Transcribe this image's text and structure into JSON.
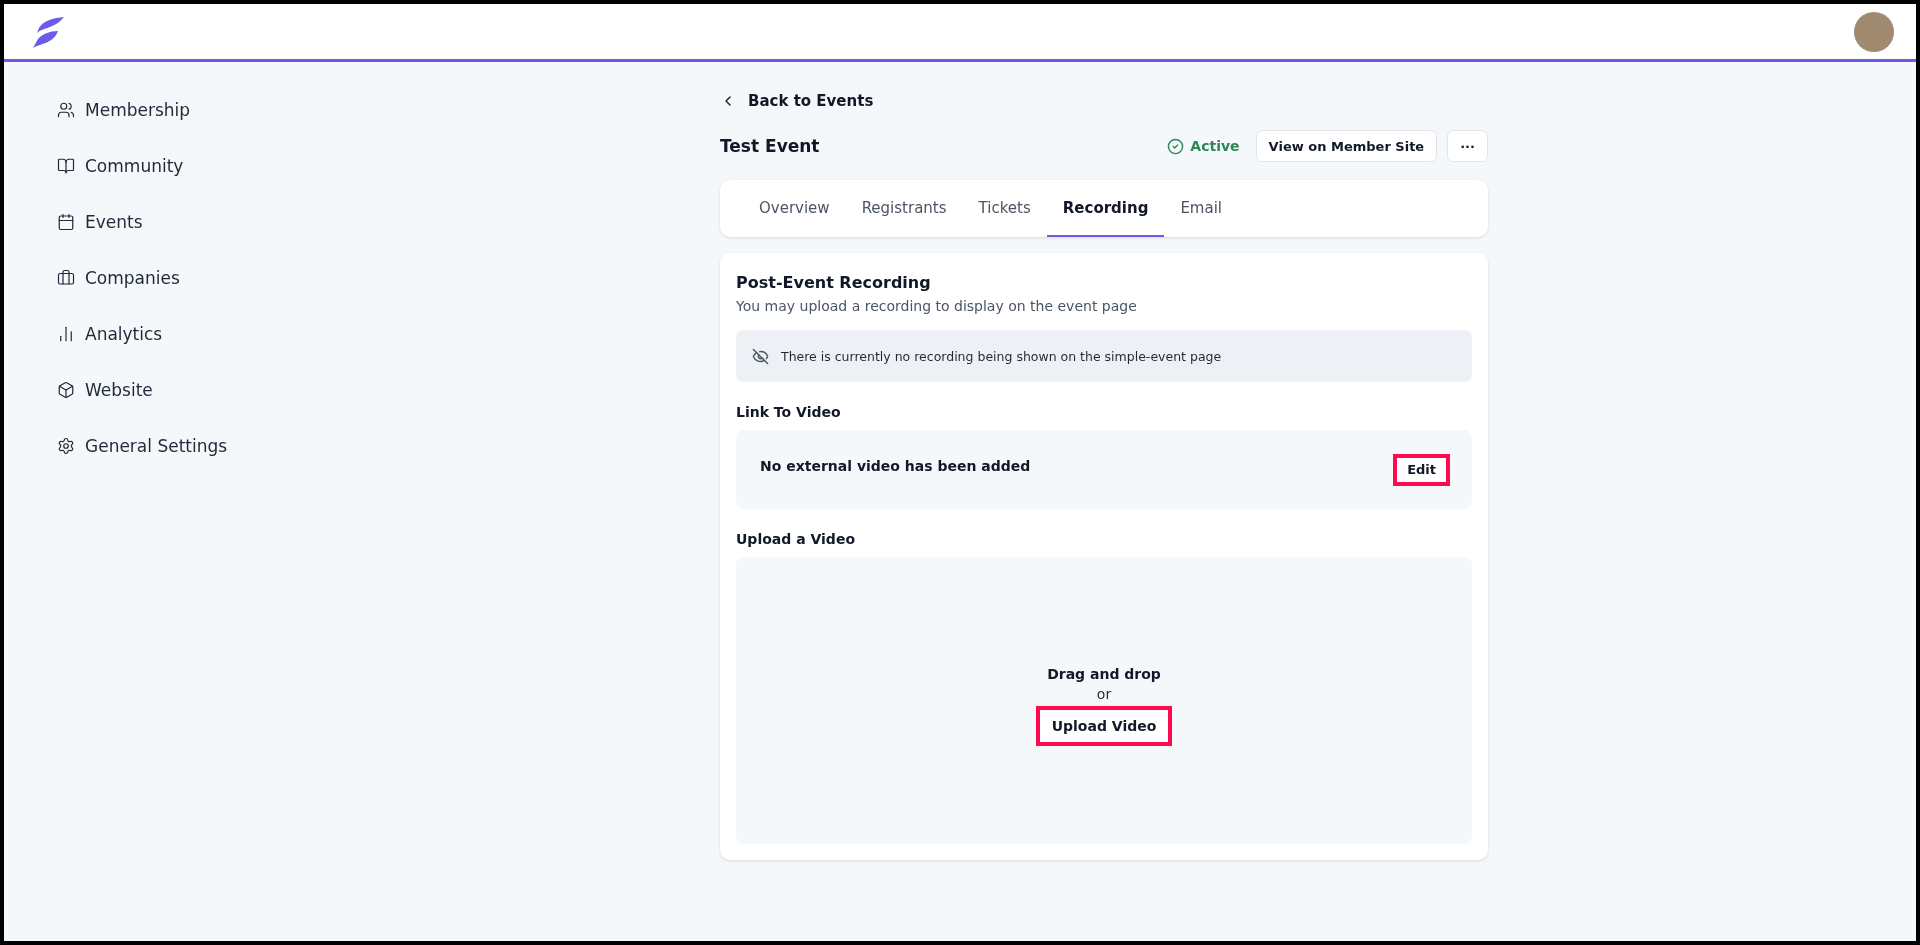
{
  "sidebar": {
    "items": [
      {
        "label": "Membership"
      },
      {
        "label": "Community"
      },
      {
        "label": "Events"
      },
      {
        "label": "Companies"
      },
      {
        "label": "Analytics"
      },
      {
        "label": "Website"
      },
      {
        "label": "General Settings"
      }
    ]
  },
  "back_link": "Back to Events",
  "event": {
    "title": "Test Event",
    "status": "Active",
    "view_button": "View on Member Site",
    "more_button": "···"
  },
  "tabs": [
    {
      "label": "Overview",
      "selected": false
    },
    {
      "label": "Registrants",
      "selected": false
    },
    {
      "label": "Tickets",
      "selected": false
    },
    {
      "label": "Recording",
      "selected": true
    },
    {
      "label": "Email",
      "selected": false
    }
  ],
  "recording": {
    "title": "Post-Event Recording",
    "subtitle": "You may upload a recording to display on the event page",
    "notice": "There is currently no recording being shown on the simple-event page",
    "link_heading": "Link To Video",
    "link_text": "No external video has been added",
    "edit_button": {
      "label": "Edit",
      "highlighted": true
    },
    "upload_heading": "Upload a Video",
    "drop_text": "Drag and drop",
    "or_text": "or",
    "upload_button": {
      "label": "Upload Video",
      "highlighted": true
    }
  }
}
